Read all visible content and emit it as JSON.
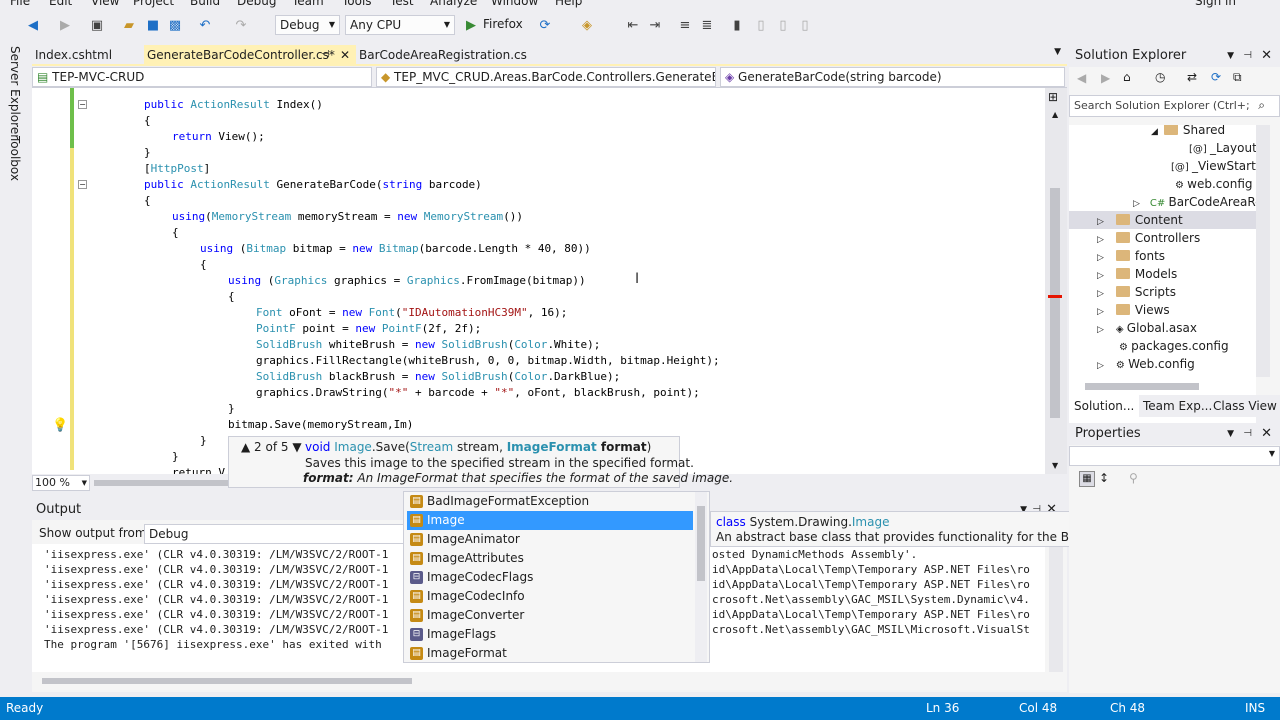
{
  "menu": [
    "File",
    "Edit",
    "View",
    "Project",
    "Build",
    "Debug",
    "Team",
    "Tools",
    "Test",
    "Analyze",
    "Window",
    "Help"
  ],
  "user": "Sign in",
  "toolbar": {
    "config": "Debug",
    "platform": "Any CPU",
    "run": "Firefox"
  },
  "left_tabs": [
    "Server Explorer",
    "Toolbox"
  ],
  "tabs": [
    {
      "label": "Index.cshtml"
    },
    {
      "label": "GenerateBarCodeController.cs*"
    },
    {
      "label": "BarCodeAreaRegistration.cs"
    }
  ],
  "nav": {
    "project": "TEP-MVC-CRUD",
    "class": "TEP_MVC_CRUD.Areas.BarCode.Controllers.GenerateBarCo",
    "member": "GenerateBarCode(string barcode)"
  },
  "code": {
    "l1": "public ActionResult Index()",
    "l2": "{",
    "l3": "return View();",
    "l4": "}",
    "l5": "[HttpPost]",
    "l6": "public ActionResult GenerateBarCode(string barcode)",
    "l7": "{",
    "l8": "using(MemoryStream memoryStream = new MemoryStream())",
    "l9": "{",
    "l10": "using (Bitmap bitmap = new Bitmap(barcode.Length * 40, 80))",
    "l11": "{",
    "l12": "using (Graphics graphics = Graphics.FromImage(bitmap))",
    "l13": "{",
    "l14": "Font oFont = new Font(\"IDAutomationHC39M\", 16);",
    "l15": "PointF point = new PointF(2f, 2f);",
    "l16": "SolidBrush whiteBrush = new SolidBrush(Color.White);",
    "l17": "graphics.FillRectangle(whiteBrush, 0, 0, bitmap.Width, bitmap.Height);",
    "l18": "SolidBrush blackBrush = new SolidBrush(Color.DarkBlue);",
    "l19": "graphics.DrawString(\"*\" + barcode + \"*\", oFont, blackBrush, point);",
    "l20": "}",
    "l21": "bitmap.Save(memoryStream,Im)",
    "l22": "}",
    "l23": "}",
    "l24": "return V"
  },
  "zoom": "100 %",
  "signature": {
    "counter": "2 of 5",
    "line1": "void Image.Save(Stream stream, ImageFormat format)",
    "line2": "Saves this image to the specified stream in the specified format.",
    "param": "format:",
    "line3": "An ImageFormat that specifies the format of the saved image."
  },
  "completion": [
    "BadImageFormatException",
    "Image",
    "ImageAnimator",
    "ImageAttributes",
    "ImageCodecFlags",
    "ImageCodecInfo",
    "ImageConverter",
    "ImageFlags",
    "ImageFormat"
  ],
  "completion_selected": 1,
  "tooltip": {
    "line1": "class System.Drawing.Image",
    "line2": "An abstract base class that provides functionality for the Bitmap and Metafile descended classes."
  },
  "output": {
    "title": "Output",
    "show_from": "Show output from:",
    "source": "Debug",
    "lines_left": [
      "'iisexpress.exe' (CLR v4.0.30319: /LM/W3SVC/2/ROOT-1",
      "'iisexpress.exe' (CLR v4.0.30319: /LM/W3SVC/2/ROOT-1",
      "'iisexpress.exe' (CLR v4.0.30319: /LM/W3SVC/2/ROOT-1",
      "'iisexpress.exe' (CLR v4.0.30319: /LM/W3SVC/2/ROOT-1",
      "'iisexpress.exe' (CLR v4.0.30319: /LM/W3SVC/2/ROOT-1",
      "'iisexpress.exe' (CLR v4.0.30319: /LM/W3SVC/2/ROOT-1",
      "The program '[5676] iisexpress.exe' has exited with"
    ],
    "lines_right": [
      "osted DynamicMethods Assembly'.",
      "id\\AppData\\Local\\Temp\\Temporary ASP.NET Files\\ro",
      "id\\AppData\\Local\\Temp\\Temporary ASP.NET Files\\ro",
      "crosoft.Net\\assembly\\GAC_MSIL\\System.Dynamic\\v4.",
      "id\\AppData\\Local\\Temp\\Temporary ASP.NET Files\\ro",
      "crosoft.Net\\assembly\\GAC_MSIL\\Microsoft.VisualSt",
      ""
    ]
  },
  "solution_explorer": {
    "title": "Solution Explorer",
    "search_placeholder": "Search Solution Explorer (Ctrl+;",
    "items": [
      "Shared",
      "_Layout.",
      "_ViewStart.c",
      "web.config",
      "BarCodeAreaRe",
      "Content",
      "Controllers",
      "fonts",
      "Models",
      "Scripts",
      "Views",
      "Global.asax",
      "packages.config",
      "Web.config"
    ],
    "bottom_tabs": [
      "Solution...",
      "Team Exp...",
      "Class View"
    ]
  },
  "properties": {
    "title": "Properties"
  },
  "status": {
    "ready": "Ready",
    "ln": "Ln 36",
    "col": "Col 48",
    "ch": "Ch 48",
    "mode": "INS"
  }
}
